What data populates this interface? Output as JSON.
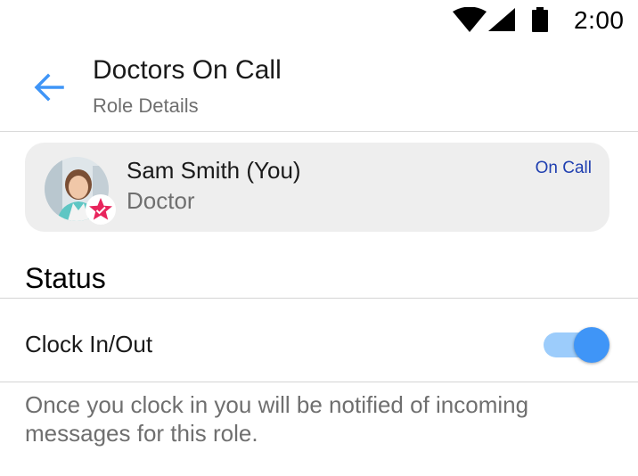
{
  "status_bar": {
    "time": "2:00",
    "icons": [
      "wifi-icon",
      "cellular-signal-icon",
      "battery-icon"
    ]
  },
  "app_bar": {
    "title": "Doctors On Call",
    "subtitle": "Role Details",
    "back_icon": "arrow-left-icon"
  },
  "user_card": {
    "name": "Sam Smith (You)",
    "role": "Doctor",
    "status": "On Call",
    "badge_icon": "star-icon"
  },
  "status_section": {
    "header": "Status",
    "setting": {
      "label": "Clock In/Out",
      "toggle_on": true
    },
    "help_text": "Once you clock in you will be notified of incoming messages for this role."
  },
  "colors": {
    "accent": "#3f95f7",
    "accent_light": "#9cccfb",
    "on_call_text": "#1f3fb0",
    "star_badge": "#e8245c",
    "card_bg": "#eeeeee"
  }
}
